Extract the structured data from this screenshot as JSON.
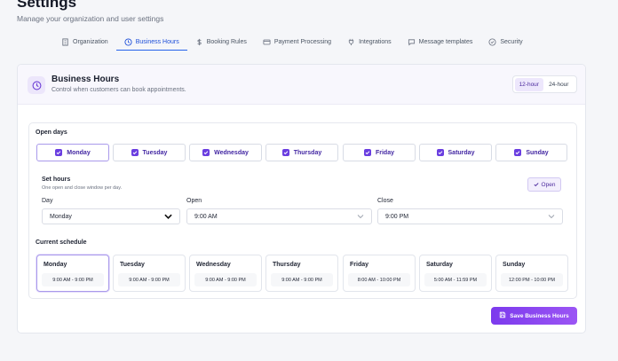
{
  "header": {
    "title": "Settings",
    "subtitle": "Manage your organization and user settings"
  },
  "tabs": [
    {
      "label": "Organization",
      "icon": "building-icon",
      "active": false
    },
    {
      "label": "Business Hours",
      "icon": "clock-icon",
      "active": true
    },
    {
      "label": "Booking Rules",
      "icon": "dollar-icon",
      "active": false
    },
    {
      "label": "Payment Processing",
      "icon": "credit-card-icon",
      "active": false
    },
    {
      "label": "Integrations",
      "icon": "plug-icon",
      "active": false
    },
    {
      "label": "Message templates",
      "icon": "message-icon",
      "active": false
    },
    {
      "label": "Security",
      "icon": "shield-check-icon",
      "active": false
    }
  ],
  "card": {
    "title": "Business Hours",
    "subtitle": "Control when customers can book appointments.",
    "format_options": [
      "12-hour",
      "24-hour"
    ],
    "format_selected": "12-hour"
  },
  "open_days": {
    "label": "Open days",
    "days": [
      "Monday",
      "Tuesday",
      "Wednesday",
      "Thursday",
      "Friday",
      "Saturday",
      "Sunday"
    ]
  },
  "set_hours": {
    "title": "Set hours",
    "subtitle": "One open and close window per day.",
    "open_toggle_label": "Open",
    "day_label": "Day",
    "day_value": "Monday",
    "open_label": "Open",
    "open_value": "9:00 AM",
    "close_label": "Close",
    "close_value": "9:00 PM"
  },
  "schedule": {
    "label": "Current schedule",
    "items": [
      {
        "day": "Monday",
        "hours": "9:00 AM - 9:00 PM"
      },
      {
        "day": "Tuesday",
        "hours": "9:00 AM - 9:00 PM"
      },
      {
        "day": "Wednesday",
        "hours": "9:00 AM - 9:00 PM"
      },
      {
        "day": "Thursday",
        "hours": "9:00 AM - 9:00 PM"
      },
      {
        "day": "Friday",
        "hours": "8:00 AM - 10:00 PM"
      },
      {
        "day": "Saturday",
        "hours": "5:00 AM - 11:59 PM"
      },
      {
        "day": "Sunday",
        "hours": "12:00 PM - 10:00 PM"
      }
    ]
  },
  "actions": {
    "save_label": "Save Business Hours"
  },
  "colors": {
    "accent": "#7c3aed",
    "tab_active": "#2563eb",
    "background": "#f5f6f9"
  }
}
